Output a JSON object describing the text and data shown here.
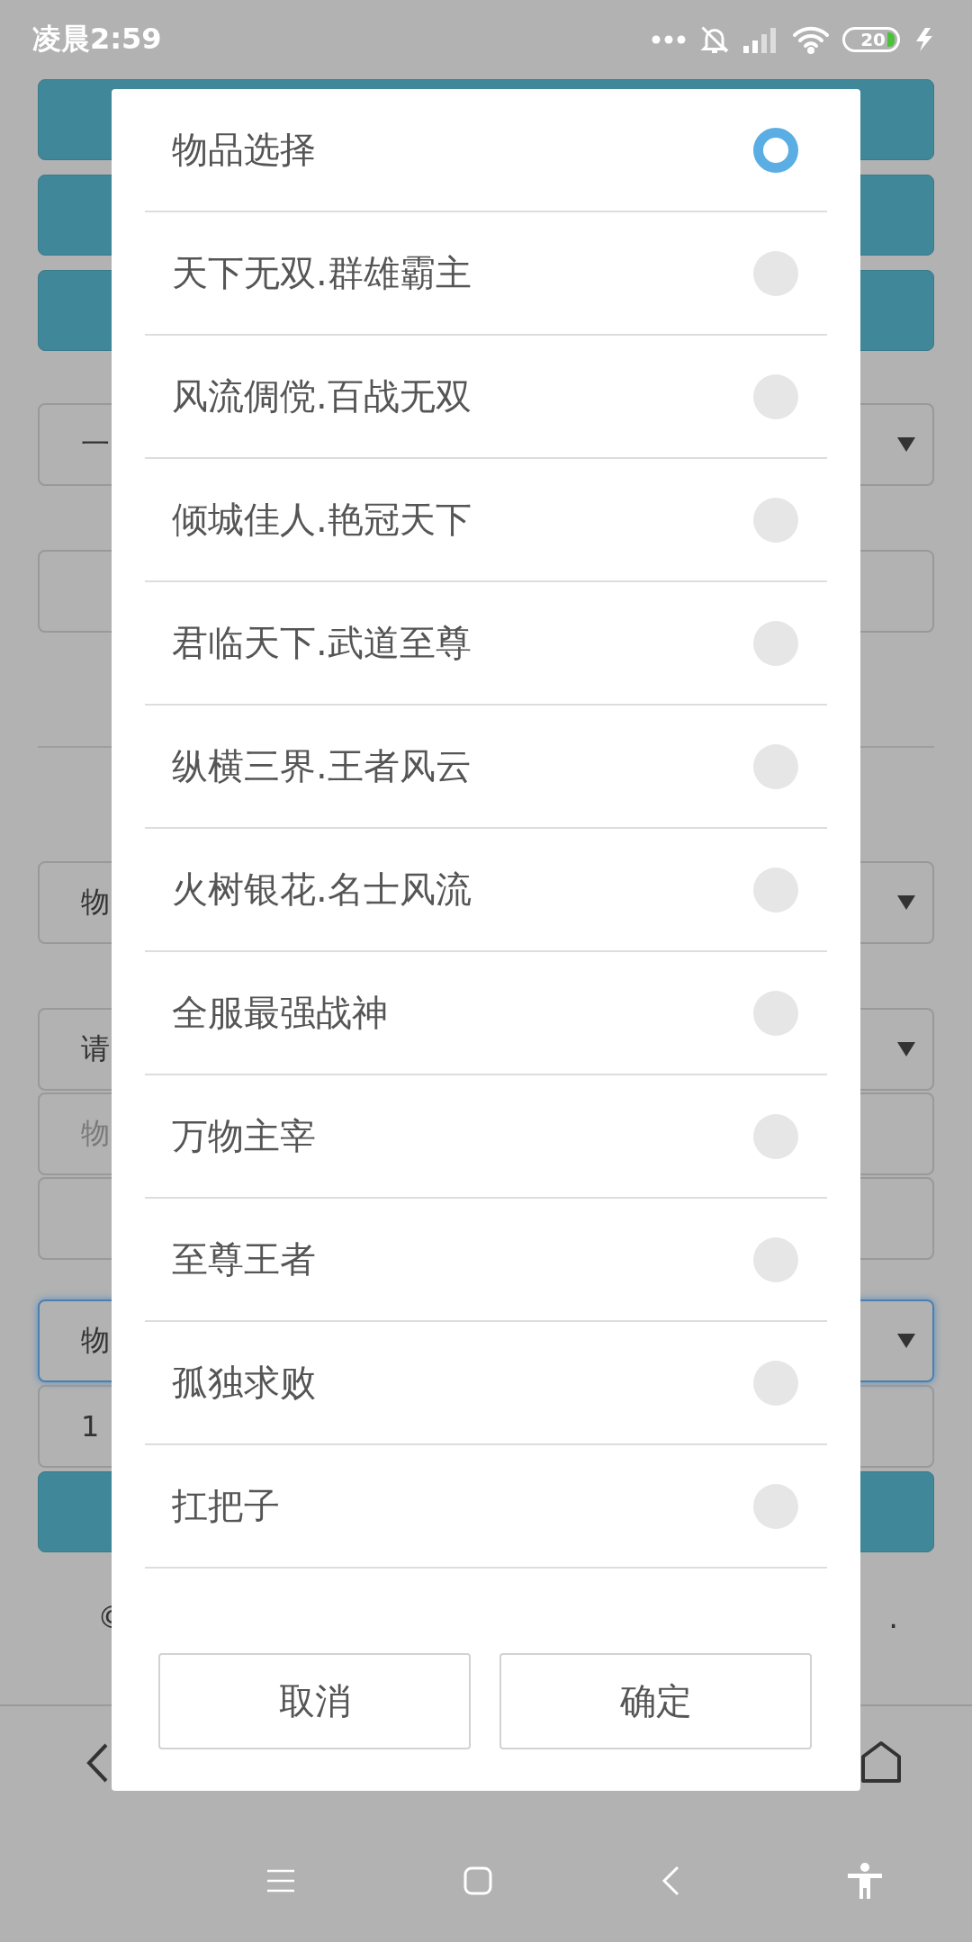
{
  "status_bar": {
    "time": "凌晨2:59",
    "battery": "20"
  },
  "page": {
    "form": [
      {
        "kind": "button"
      },
      {
        "kind": "button"
      },
      {
        "kind": "button"
      },
      {
        "kind": "select",
        "value": "一",
        "focused": false
      },
      {
        "kind": "input"
      },
      {
        "kind": "divider"
      },
      {
        "kind": "select",
        "value": "物",
        "focused": false
      },
      {
        "kind": "select",
        "value": "请",
        "focused": false
      },
      {
        "kind": "input",
        "placeholder": "物"
      },
      {
        "kind": "input"
      },
      {
        "kind": "select",
        "value": "物",
        "focused": true
      },
      {
        "kind": "input",
        "value": "1"
      },
      {
        "kind": "button"
      }
    ],
    "footer": {
      "left": "©",
      "right": "."
    }
  },
  "dialog": {
    "options": [
      {
        "label": "物品选择",
        "selected": true
      },
      {
        "label": "天下无双.群雄霸主",
        "selected": false
      },
      {
        "label": "风流倜傥.百战无双",
        "selected": false
      },
      {
        "label": "倾城佳人.艳冠天下",
        "selected": false
      },
      {
        "label": "君临天下.武道至尊",
        "selected": false
      },
      {
        "label": "纵横三界.王者风云",
        "selected": false
      },
      {
        "label": "火树银花.名士风流",
        "selected": false
      },
      {
        "label": "全服最强战神",
        "selected": false
      },
      {
        "label": "万物主宰",
        "selected": false
      },
      {
        "label": "至尊王者",
        "selected": false
      },
      {
        "label": "孤独求败",
        "selected": false
      },
      {
        "label": "扛把子",
        "selected": false
      }
    ],
    "buttons": [
      "取消",
      "确定"
    ]
  }
}
